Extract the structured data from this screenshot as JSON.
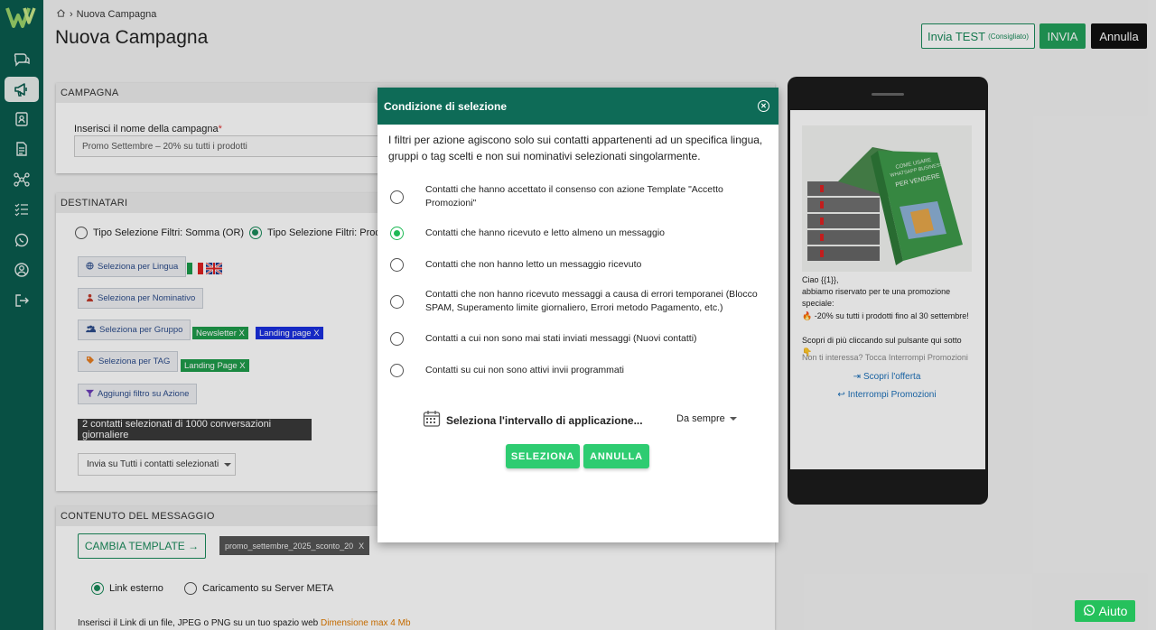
{
  "breadcrumb": {
    "current": "Nuova Campagna"
  },
  "page": {
    "title": "Nuova Campagna"
  },
  "header_buttons": {
    "test_label": "Invia TEST",
    "test_hint": "(Consigliato)",
    "send_label": "INVIA",
    "cancel_label": "Annulla"
  },
  "campaign": {
    "header": "CAMPAGNA",
    "name_label": "Inserisci il nome della campagna",
    "required_mark": "*",
    "name_value": "Promo Settembre – 20% su tutti i prodotti"
  },
  "recipients": {
    "header": "DESTINATARI",
    "radio_or": "Tipo Selezione Filtri: Somma (OR)",
    "radio_and": "Tipo Selezione Filtri: Prodo",
    "btn_language": "Seleziona per Lingua",
    "btn_nominative": "Seleziona per Nominativo",
    "btn_group": "Seleziona per Gruppo",
    "btn_tag": "Seleziona per TAG",
    "btn_action_filter": "Aggiungi filtro su Azione",
    "group_tags": [
      {
        "label": "Newsletter X"
      },
      {
        "label": "Landing page X"
      }
    ],
    "tag_tags": [
      {
        "label": "Landing Page  X"
      }
    ],
    "selected_contacts": "2 contatti selezionati di 1000 conversazioni giornaliere",
    "send_option": "Invia su Tutti i contatti selezionati"
  },
  "content": {
    "header": "CONTENUTO DEL MESSAGGIO",
    "change_template": "CAMBIA TEMPLATE →",
    "template_name": "promo_settembre_2025_sconto_20",
    "template_remove": "X",
    "radio_external": "Link esterno",
    "radio_meta": "Caricamento su Server META",
    "bottom_text": "Inserisci il Link di un file, JPEG o PNG su un tuo spazio web",
    "bottom_hint": "Dimensione max 4 Mb"
  },
  "preview": {
    "line1": "Ciao {{1}},",
    "line2": "abbiamo riservato per te una promozione speciale:",
    "line3": "🔥 -20% su tutti i prodotti fino al 30 settembre!",
    "line4": "Scopri di più cliccando sul pulsante qui sotto 👇",
    "footer": "Non ti interessa? Tocca Interrompi Promozioni",
    "cta1": "Scopri l'offerta",
    "cta2": "Interrompi Promozioni",
    "book_top": "COME USARE",
    "book_mid": "WHATSAPP BUSINESS",
    "book_bottom": "PER VENDERE"
  },
  "modal": {
    "title": "Condizione di selezione",
    "description": "I filtri per azione agiscono solo sui contatti appartenenti ad un specifica lingua, gruppi o tag scelti e non sui nominativi selezionati singolarmente.",
    "options": [
      {
        "label": "Contatti che hanno accettato il consenso con azione Template \"Accetto Promozioni\"",
        "selected": false
      },
      {
        "label": "Contatti che hanno ricevuto e letto almeno un messaggio",
        "selected": true
      },
      {
        "label": "Contatti che non hanno letto un messaggio ricevuto",
        "selected": false
      },
      {
        "label": "Contatti che non hanno ricevuto messaggi a causa di errori temporanei (Blocco SPAM, Superamento limite giornaliero, Errori metodo Pagamento, etc.)",
        "selected": false
      },
      {
        "label": "Contatti a cui non sono mai stati inviati messaggi (Nuovi contatti)",
        "selected": false
      },
      {
        "label": "Contatti su cui non sono attivi invii programmati",
        "selected": false
      }
    ],
    "interval_label": "Seleziona l'intervallo di applicazione...",
    "interval_value": "Da sempre",
    "btn_select": "SELEZIONA",
    "btn_cancel": "ANNULLA"
  },
  "help": {
    "label": "Aiuto"
  },
  "colors": {
    "brand": "#0a5c4e",
    "modal_header": "#0e6b57",
    "primary_green": "#2ecc71",
    "accent": "#1a8a5a"
  }
}
